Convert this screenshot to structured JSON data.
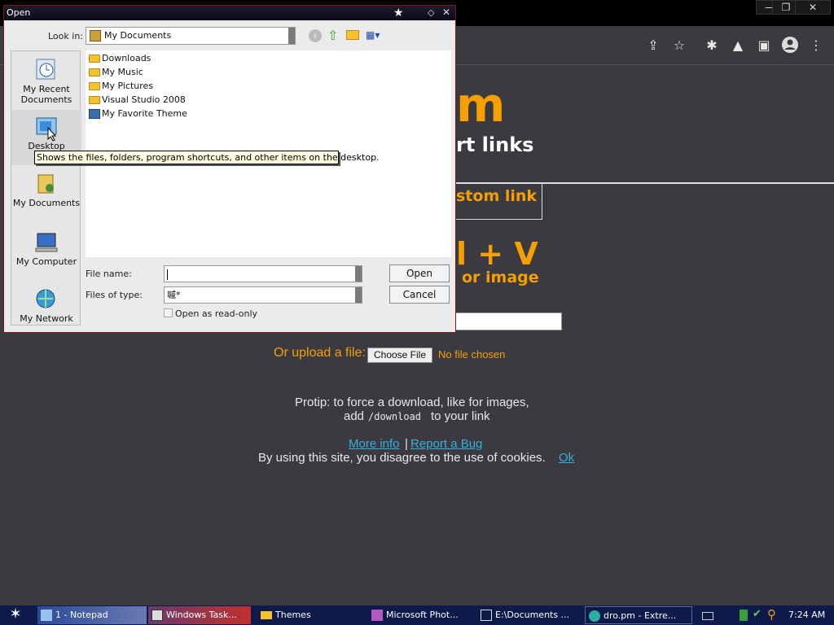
{
  "browser": {
    "window_controls": [
      "—",
      "❐",
      "✕"
    ],
    "toolbar_icons": [
      "share-icon",
      "star-icon",
      "extensions-icon",
      "flask-icon",
      "sidebar-icon",
      "profile-icon",
      "menu-icon"
    ]
  },
  "page": {
    "logo_partial": "m",
    "tagline_partial": "rt links",
    "custom_link_partial": "stom link",
    "paste_hint_partial": "l + V",
    "paste_sub_partial": "or image",
    "upload_label": "Or upload a file:",
    "choose_file": "Choose File",
    "no_file": "No file chosen",
    "protip_line1": "Protip: to force a download, like for images,",
    "protip_add": "add",
    "protip_code": "/download",
    "protip_rest": "to your link",
    "more_info": "More info",
    "separator": "|",
    "report_bug": "Report a Bug",
    "cookie_text": "By using this site, you disagree to the use of cookies.",
    "cookie_ok": "Ok",
    "colors": {
      "accent": "#f5a000",
      "link": "#35b0e0",
      "background": "#3a3a40"
    }
  },
  "dialog": {
    "title": "Open",
    "look_in_label": "Look in:",
    "look_in_value": "My Documents",
    "places": [
      {
        "label1": "My Recent",
        "label2": "Documents"
      },
      {
        "label1": "Desktop",
        "label2": ""
      },
      {
        "label1": "My Documents",
        "label2": ""
      },
      {
        "label1": "My Computer",
        "label2": ""
      },
      {
        "label1": "My Network",
        "label2": ""
      }
    ],
    "files": [
      "Downloads",
      "My Music",
      "My Pictures",
      "Visual Studio 2008",
      "My Favorite Theme"
    ],
    "tooltip": "Shows the files, folders, program shortcuts, and other items on the desktop.",
    "file_name_label": "File name:",
    "file_name_value": "",
    "files_of_type_label": "Files of type:",
    "files_of_type_value": "嘁*",
    "read_only_label": "Open as read-only",
    "open_button": "Open",
    "cancel_button": "Cancel"
  },
  "taskbar": {
    "items": [
      {
        "label": "1 - Notepad"
      },
      {
        "label": "Windows Task..."
      },
      {
        "label": "Themes"
      },
      {
        "label": "Microsoft Phot..."
      },
      {
        "label": "E:\\Documents ..."
      },
      {
        "label": "dro.pm - Extre..."
      }
    ],
    "clock": "7:24 AM"
  }
}
